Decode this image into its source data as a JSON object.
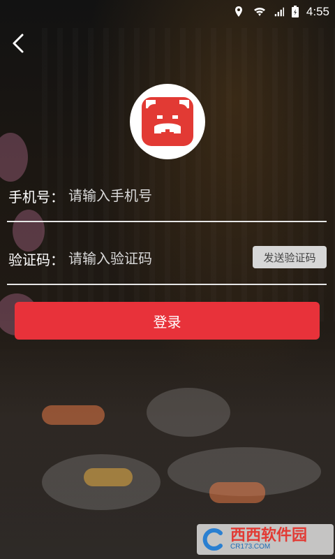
{
  "status_bar": {
    "time": "4:55",
    "icons": [
      "location-icon",
      "wifi-icon",
      "signal-icon",
      "battery-icon"
    ]
  },
  "nav": {
    "back_icon": "chevron-left-icon"
  },
  "logo": {
    "icon": "bear-logo-icon",
    "colors": {
      "brand": "#e23a34",
      "circle": "#ffffff"
    }
  },
  "form": {
    "phone": {
      "label": "手机号：",
      "placeholder": "请输入手机号",
      "value": ""
    },
    "code": {
      "label": "验证码：",
      "placeholder": "请输入验证码",
      "value": "",
      "send_button": "发送验证码"
    },
    "login_button": "登录"
  },
  "watermark": {
    "text": "西西软件园",
    "sub": "CR173.COM"
  },
  "colors": {
    "accent": "#e8323a",
    "input_line": "#e6e6e6",
    "send_btn_bg": "#d7d7d7"
  }
}
